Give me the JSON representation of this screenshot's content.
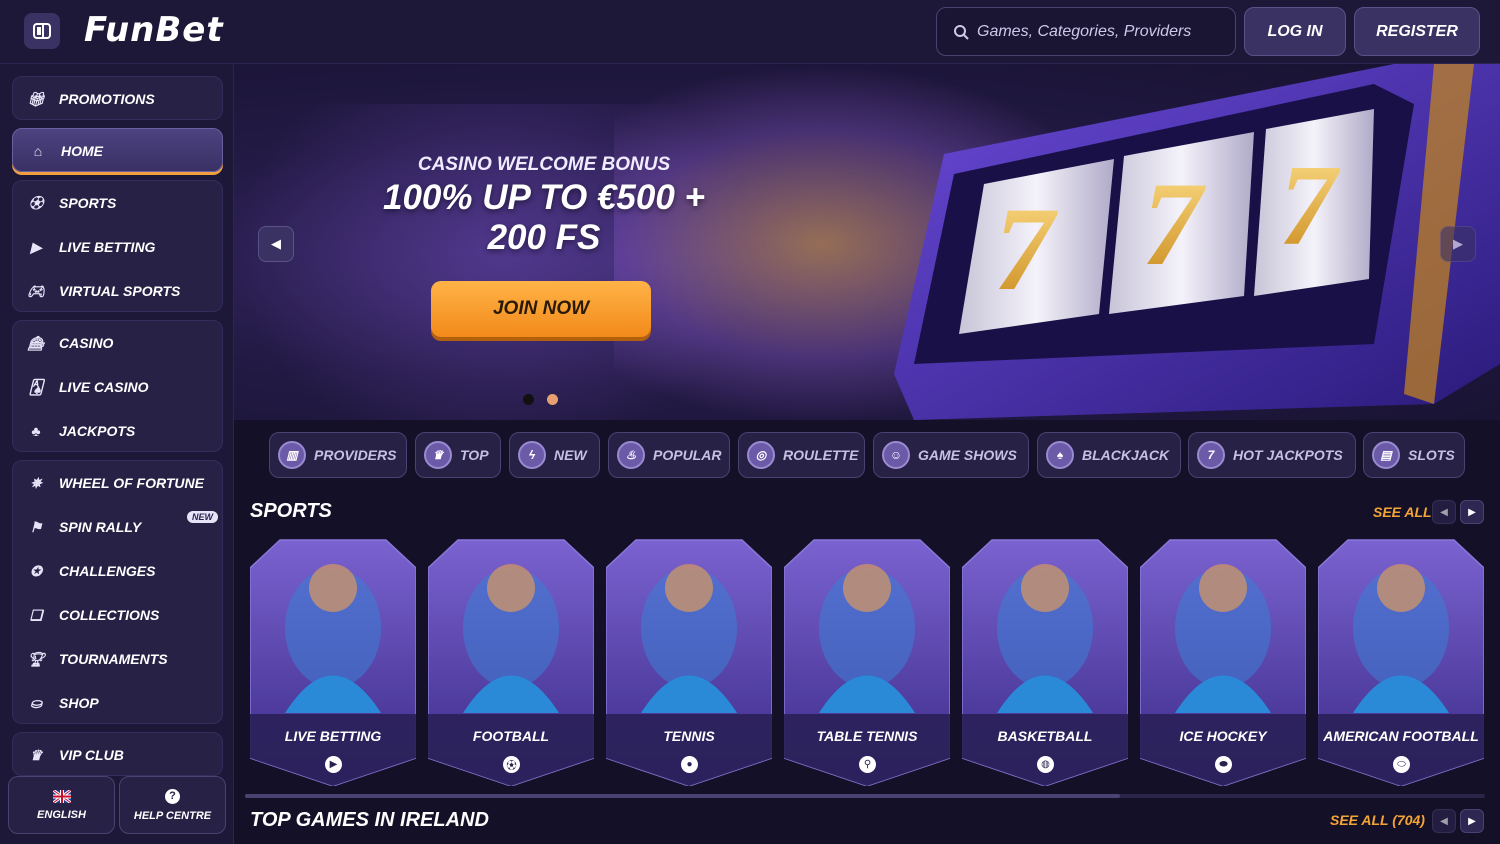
{
  "header": {
    "logo": "FunBet",
    "search_placeholder": "Games, Categories, Providers",
    "login_label": "LOG IN",
    "register_label": "REGISTER"
  },
  "sidebar": {
    "items": [
      {
        "label": "PROMOTIONS",
        "icon": "gift-icon"
      },
      {
        "label": "HOME",
        "icon": "home-icon"
      },
      {
        "label": "SPORTS",
        "icon": "soccer-ball-icon"
      },
      {
        "label": "LIVE BETTING",
        "icon": "live-play-icon"
      },
      {
        "label": "VIRTUAL SPORTS",
        "icon": "gamepad-icon"
      },
      {
        "label": "CASINO",
        "icon": "slot-machine-icon"
      },
      {
        "label": "LIVE CASINO",
        "icon": "live-cards-icon"
      },
      {
        "label": "JACKPOTS",
        "icon": "clover-icon"
      },
      {
        "label": "WHEEL OF FORTUNE",
        "icon": "wheel-icon"
      },
      {
        "label": "SPIN RALLY",
        "icon": "checkered-flag-icon",
        "badge": "NEW"
      },
      {
        "label": "CHALLENGES",
        "icon": "medal-icon"
      },
      {
        "label": "COLLECTIONS",
        "icon": "cards-icon"
      },
      {
        "label": "TOURNAMENTS",
        "icon": "trophy-icon"
      },
      {
        "label": "SHOP",
        "icon": "shop-icon"
      },
      {
        "label": "VIP CLUB",
        "icon": "crown-icon"
      }
    ],
    "footer": {
      "language_label": "ENGLISH",
      "help_label": "HELP CENTRE"
    }
  },
  "banner": {
    "kicker": "CASINO WELCOME BONUS",
    "title_line1": "100% UP TO €500 +",
    "title_line2": "200 FS",
    "cta_label": "JOIN NOW",
    "slide_count": 2,
    "active_slide": 1
  },
  "categories": [
    {
      "label": "PROVIDERS",
      "icon": "book-icon"
    },
    {
      "label": "TOP",
      "icon": "crown-icon"
    },
    {
      "label": "NEW",
      "icon": "lightning-icon"
    },
    {
      "label": "POPULAR",
      "icon": "flame-icon"
    },
    {
      "label": "ROULETTE",
      "icon": "roulette-icon"
    },
    {
      "label": "GAME SHOWS",
      "icon": "host-icon"
    },
    {
      "label": "BLACKJACK",
      "icon": "spade-icon"
    },
    {
      "label": "HOT JACKPOTS",
      "icon": "seven-icon"
    },
    {
      "label": "SLOTS",
      "icon": "slot-icon"
    }
  ],
  "sports": {
    "title": "SPORTS",
    "see_all": "SEE ALL",
    "cards": [
      {
        "label": "LIVE BETTING",
        "icon": "play-icon"
      },
      {
        "label": "FOOTBALL",
        "icon": "soccer-ball-icon"
      },
      {
        "label": "TENNIS",
        "icon": "tennis-ball-icon"
      },
      {
        "label": "TABLE TENNIS",
        "icon": "paddle-icon"
      },
      {
        "label": "BASKETBALL",
        "icon": "basketball-icon"
      },
      {
        "label": "ICE HOCKEY",
        "icon": "puck-icon"
      },
      {
        "label": "AMERICAN FOOTBALL",
        "icon": "rugby-ball-icon"
      }
    ]
  },
  "top_games": {
    "title": "TOP GAMES IN IRELAND",
    "see_all": "SEE ALL",
    "count": "(704)"
  },
  "colors": {
    "accent": "#f5a536",
    "sidebar_bg": "#1e1838",
    "page_bg": "#141028",
    "card_purple": "#5b46b0"
  }
}
